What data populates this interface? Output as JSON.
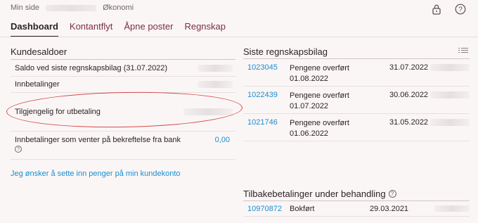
{
  "header": {
    "breadcrumb_prefix": "Min side",
    "breadcrumb_suffix": "Økonomi",
    "lock_icon": "lock-icon",
    "help_icon": "help-icon"
  },
  "tabs": [
    {
      "label": "Dashboard",
      "active": true
    },
    {
      "label": "Kontantflyt",
      "active": false
    },
    {
      "label": "Åpne poster",
      "active": false
    },
    {
      "label": "Regnskap",
      "active": false
    }
  ],
  "customer_balance": {
    "title": "Kundesaldoer",
    "rows": [
      {
        "label": "Saldo ved siste regnskapsbilag (31.07.2022)"
      },
      {
        "label": "Innbetalinger"
      },
      {
        "label": "Tilgjengelig for utbetaling"
      },
      {
        "label": "Innbetalinger som venter på bekreftelse fra bank",
        "value": "0,00"
      }
    ],
    "help_glyph": "?"
  },
  "deposit_link": "Jeg ønsker å sette inn penger på min kundekonto",
  "latest_vouchers": {
    "title": "Siste regnskapsbilag",
    "entries": [
      {
        "number": "1023045",
        "desc_line1": "Pengene overført",
        "desc_line2": "01.08.2022",
        "date": "31.07.2022"
      },
      {
        "number": "1022439",
        "desc_line1": "Pengene overført",
        "desc_line2": "01.07.2022",
        "date": "30.06.2022"
      },
      {
        "number": "1021746",
        "desc_line1": "Pengene overført",
        "desc_line2": "01.06.2022",
        "date": "31.05.2022"
      }
    ]
  },
  "refunds": {
    "title": "Tilbakebetalinger under behandling",
    "help_glyph": "?",
    "rows": [
      {
        "number": "10970872",
        "status": "Bokført",
        "date": "29.03.2021"
      }
    ]
  },
  "colors": {
    "link": "#1a8ed1",
    "tab_inactive": "#7a2d4b",
    "highlight": "#d24a4a",
    "background": "#fbf6f6"
  }
}
